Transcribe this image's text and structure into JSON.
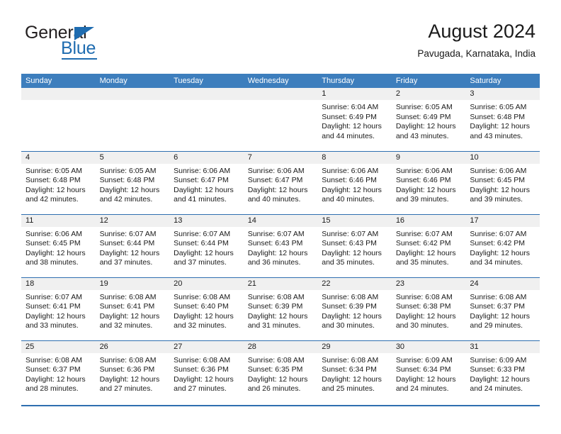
{
  "brand": {
    "name_top": "General",
    "name_bottom": "Blue",
    "triangle_color": "#1f6cb0",
    "text_color": "#231f20"
  },
  "header": {
    "title": "August 2024",
    "subtitle": "Pavugada, Karnataka, India"
  },
  "theme": {
    "header_row_bg": "#3d7ebd",
    "row_divider": "#2f6fb0",
    "daynum_band_bg": "#f0f0f0",
    "text": "#1a1a1a"
  },
  "weekday_headers": [
    "Sunday",
    "Monday",
    "Tuesday",
    "Wednesday",
    "Thursday",
    "Friday",
    "Saturday"
  ],
  "labels": {
    "sunrise_prefix": "Sunrise:",
    "sunset_prefix": "Sunset:",
    "daylight_prefix": "Daylight:"
  },
  "weeks": [
    [
      {
        "empty": true
      },
      {
        "empty": true
      },
      {
        "empty": true
      },
      {
        "empty": true
      },
      {
        "day": "1",
        "sunrise": "Sunrise: 6:04 AM",
        "sunset": "Sunset: 6:49 PM",
        "daylight": "Daylight: 12 hours and 44 minutes."
      },
      {
        "day": "2",
        "sunrise": "Sunrise: 6:05 AM",
        "sunset": "Sunset: 6:49 PM",
        "daylight": "Daylight: 12 hours and 43 minutes."
      },
      {
        "day": "3",
        "sunrise": "Sunrise: 6:05 AM",
        "sunset": "Sunset: 6:48 PM",
        "daylight": "Daylight: 12 hours and 43 minutes."
      }
    ],
    [
      {
        "day": "4",
        "sunrise": "Sunrise: 6:05 AM",
        "sunset": "Sunset: 6:48 PM",
        "daylight": "Daylight: 12 hours and 42 minutes."
      },
      {
        "day": "5",
        "sunrise": "Sunrise: 6:05 AM",
        "sunset": "Sunset: 6:48 PM",
        "daylight": "Daylight: 12 hours and 42 minutes."
      },
      {
        "day": "6",
        "sunrise": "Sunrise: 6:06 AM",
        "sunset": "Sunset: 6:47 PM",
        "daylight": "Daylight: 12 hours and 41 minutes."
      },
      {
        "day": "7",
        "sunrise": "Sunrise: 6:06 AM",
        "sunset": "Sunset: 6:47 PM",
        "daylight": "Daylight: 12 hours and 40 minutes."
      },
      {
        "day": "8",
        "sunrise": "Sunrise: 6:06 AM",
        "sunset": "Sunset: 6:46 PM",
        "daylight": "Daylight: 12 hours and 40 minutes."
      },
      {
        "day": "9",
        "sunrise": "Sunrise: 6:06 AM",
        "sunset": "Sunset: 6:46 PM",
        "daylight": "Daylight: 12 hours and 39 minutes."
      },
      {
        "day": "10",
        "sunrise": "Sunrise: 6:06 AM",
        "sunset": "Sunset: 6:45 PM",
        "daylight": "Daylight: 12 hours and 39 minutes."
      }
    ],
    [
      {
        "day": "11",
        "sunrise": "Sunrise: 6:06 AM",
        "sunset": "Sunset: 6:45 PM",
        "daylight": "Daylight: 12 hours and 38 minutes."
      },
      {
        "day": "12",
        "sunrise": "Sunrise: 6:07 AM",
        "sunset": "Sunset: 6:44 PM",
        "daylight": "Daylight: 12 hours and 37 minutes."
      },
      {
        "day": "13",
        "sunrise": "Sunrise: 6:07 AM",
        "sunset": "Sunset: 6:44 PM",
        "daylight": "Daylight: 12 hours and 37 minutes."
      },
      {
        "day": "14",
        "sunrise": "Sunrise: 6:07 AM",
        "sunset": "Sunset: 6:43 PM",
        "daylight": "Daylight: 12 hours and 36 minutes."
      },
      {
        "day": "15",
        "sunrise": "Sunrise: 6:07 AM",
        "sunset": "Sunset: 6:43 PM",
        "daylight": "Daylight: 12 hours and 35 minutes."
      },
      {
        "day": "16",
        "sunrise": "Sunrise: 6:07 AM",
        "sunset": "Sunset: 6:42 PM",
        "daylight": "Daylight: 12 hours and 35 minutes."
      },
      {
        "day": "17",
        "sunrise": "Sunrise: 6:07 AM",
        "sunset": "Sunset: 6:42 PM",
        "daylight": "Daylight: 12 hours and 34 minutes."
      }
    ],
    [
      {
        "day": "18",
        "sunrise": "Sunrise: 6:07 AM",
        "sunset": "Sunset: 6:41 PM",
        "daylight": "Daylight: 12 hours and 33 minutes."
      },
      {
        "day": "19",
        "sunrise": "Sunrise: 6:08 AM",
        "sunset": "Sunset: 6:41 PM",
        "daylight": "Daylight: 12 hours and 32 minutes."
      },
      {
        "day": "20",
        "sunrise": "Sunrise: 6:08 AM",
        "sunset": "Sunset: 6:40 PM",
        "daylight": "Daylight: 12 hours and 32 minutes."
      },
      {
        "day": "21",
        "sunrise": "Sunrise: 6:08 AM",
        "sunset": "Sunset: 6:39 PM",
        "daylight": "Daylight: 12 hours and 31 minutes."
      },
      {
        "day": "22",
        "sunrise": "Sunrise: 6:08 AM",
        "sunset": "Sunset: 6:39 PM",
        "daylight": "Daylight: 12 hours and 30 minutes."
      },
      {
        "day": "23",
        "sunrise": "Sunrise: 6:08 AM",
        "sunset": "Sunset: 6:38 PM",
        "daylight": "Daylight: 12 hours and 30 minutes."
      },
      {
        "day": "24",
        "sunrise": "Sunrise: 6:08 AM",
        "sunset": "Sunset: 6:37 PM",
        "daylight": "Daylight: 12 hours and 29 minutes."
      }
    ],
    [
      {
        "day": "25",
        "sunrise": "Sunrise: 6:08 AM",
        "sunset": "Sunset: 6:37 PM",
        "daylight": "Daylight: 12 hours and 28 minutes."
      },
      {
        "day": "26",
        "sunrise": "Sunrise: 6:08 AM",
        "sunset": "Sunset: 6:36 PM",
        "daylight": "Daylight: 12 hours and 27 minutes."
      },
      {
        "day": "27",
        "sunrise": "Sunrise: 6:08 AM",
        "sunset": "Sunset: 6:36 PM",
        "daylight": "Daylight: 12 hours and 27 minutes."
      },
      {
        "day": "28",
        "sunrise": "Sunrise: 6:08 AM",
        "sunset": "Sunset: 6:35 PM",
        "daylight": "Daylight: 12 hours and 26 minutes."
      },
      {
        "day": "29",
        "sunrise": "Sunrise: 6:08 AM",
        "sunset": "Sunset: 6:34 PM",
        "daylight": "Daylight: 12 hours and 25 minutes."
      },
      {
        "day": "30",
        "sunrise": "Sunrise: 6:09 AM",
        "sunset": "Sunset: 6:34 PM",
        "daylight": "Daylight: 12 hours and 24 minutes."
      },
      {
        "day": "31",
        "sunrise": "Sunrise: 6:09 AM",
        "sunset": "Sunset: 6:33 PM",
        "daylight": "Daylight: 12 hours and 24 minutes."
      }
    ]
  ]
}
